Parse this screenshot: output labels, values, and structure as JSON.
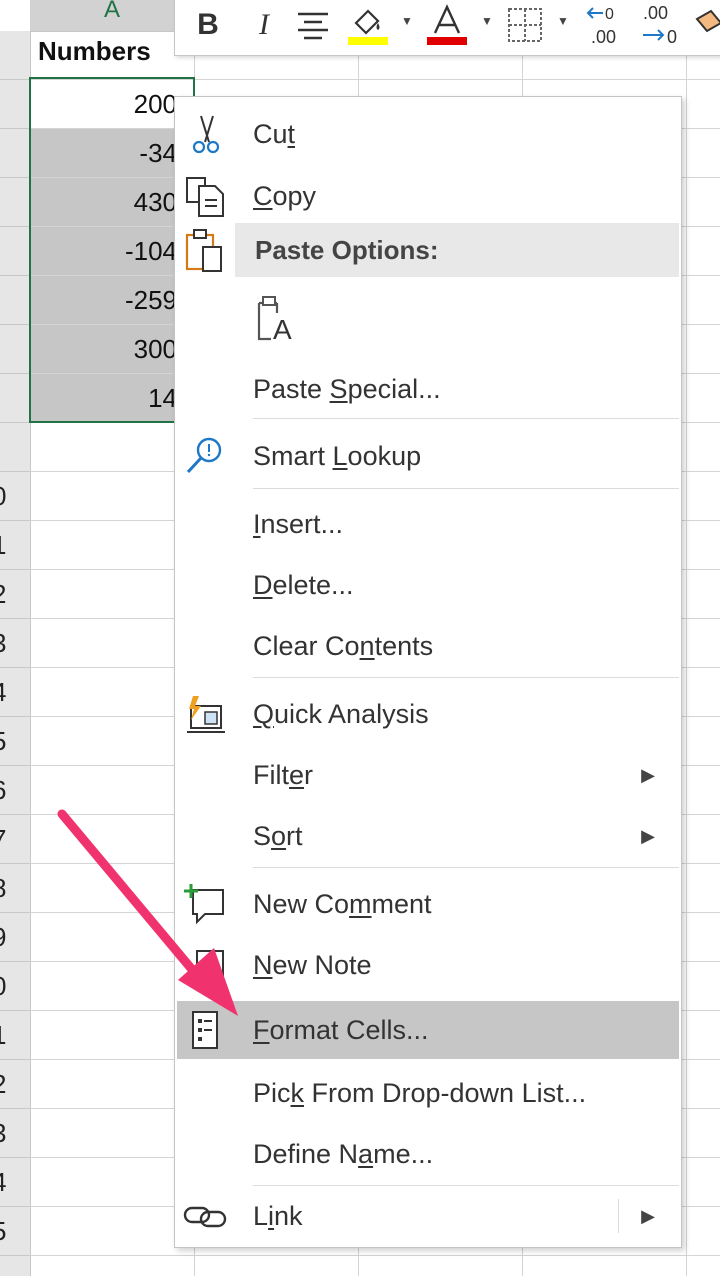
{
  "sheet": {
    "column_header": "A",
    "row_numbers": [
      "",
      "",
      "",
      "",
      "",
      "",
      "",
      "",
      "",
      "0",
      "1",
      "2",
      "3",
      "4",
      "5",
      "6",
      "7",
      "8",
      "9",
      "0",
      "1",
      "2",
      "3",
      "4",
      "5"
    ],
    "header_cell": "Numbers",
    "cells": [
      "200",
      "-34",
      "430",
      "-104",
      "-259",
      "300",
      "14"
    ]
  },
  "toolbar": {
    "bold": "B",
    "italic": "I",
    "items": [
      "bold-icon",
      "italic-icon",
      "align-center-icon",
      "fill-color-icon",
      "font-color-icon",
      "borders-icon",
      "decrease-decimal-icon",
      "increase-decimal-icon",
      "format-painter-icon"
    ],
    "fill_color": "#ffff00",
    "font_color": "#e00000"
  },
  "menu": {
    "items": [
      {
        "label_pre": "Cu",
        "label_u": "t",
        "label_post": ""
      },
      {
        "label_pre": "",
        "label_u": "C",
        "label_post": "opy"
      },
      {
        "paste_header": "Paste Options:"
      },
      {
        "label_pre": "Paste ",
        "label_u": "S",
        "label_post": "pecial..."
      },
      {
        "label_pre": "Smart ",
        "label_u": "L",
        "label_post": "ookup"
      },
      {
        "label_pre": "",
        "label_u": "I",
        "label_post": "nsert..."
      },
      {
        "label_pre": "",
        "label_u": "D",
        "label_post": "elete..."
      },
      {
        "label_pre": "Clear Co",
        "label_u": "n",
        "label_post": "tents"
      },
      {
        "label_pre": "",
        "label_u": "Q",
        "label_post": "uick Analysis"
      },
      {
        "label_pre": "Filt",
        "label_u": "e",
        "label_post": "r"
      },
      {
        "label_pre": "S",
        "label_u": "o",
        "label_post": "rt"
      },
      {
        "label_pre": "New Co",
        "label_u": "m",
        "label_post": "ment"
      },
      {
        "label_pre": "",
        "label_u": "N",
        "label_post": "ew Note"
      },
      {
        "label_pre": "",
        "label_u": "F",
        "label_post": "ormat Cells..."
      },
      {
        "label_pre": "Pic",
        "label_u": "k",
        "label_post": " From Drop-down List..."
      },
      {
        "label_pre": "Define N",
        "label_u": "a",
        "label_post": "me..."
      },
      {
        "label_pre": "L",
        "label_u": "i",
        "label_post": "nk"
      }
    ]
  },
  "colors": {
    "selection_border": "#217346",
    "highlight": "#c6c6c6",
    "annotation_arrow": "#f0336f"
  }
}
